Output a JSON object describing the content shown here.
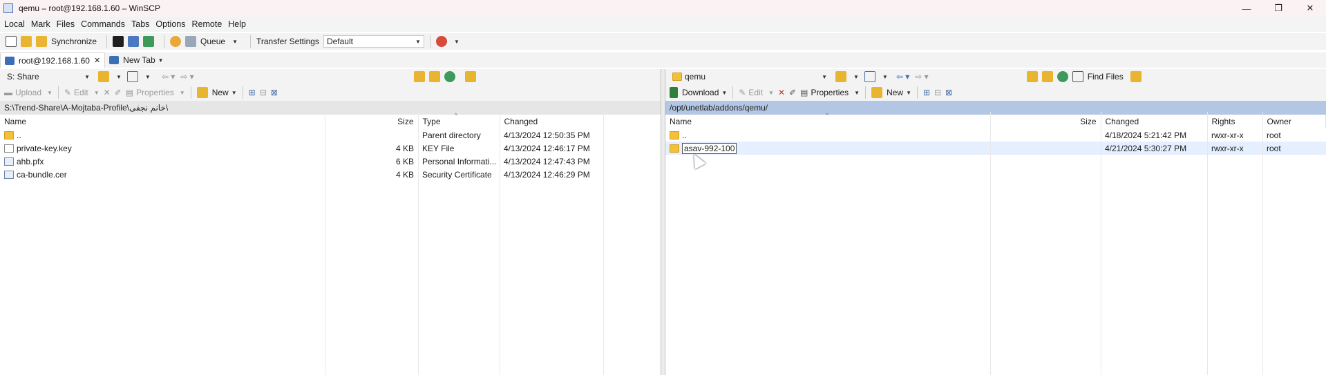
{
  "window": {
    "title": "qemu – root@192.168.1.60 – WinSCP",
    "controls": [
      "—",
      "❐",
      "✕"
    ]
  },
  "menu": [
    "Local",
    "Mark",
    "Files",
    "Commands",
    "Tabs",
    "Options",
    "Remote",
    "Help"
  ],
  "toolbar": {
    "synchronize": "Synchronize",
    "queue": "Queue",
    "transfer_settings": "Transfer Settings",
    "transfer_profile": "Default"
  },
  "tabs": [
    {
      "label": "root@192.168.1.60",
      "close": "✕"
    },
    {
      "label": "New Tab"
    }
  ],
  "left": {
    "drive": "S: Share",
    "actions": {
      "upload": "Upload",
      "edit": "Edit",
      "properties": "Properties",
      "new": "New"
    },
    "path": "S:\\Trend-Share\\A-Mojtaba-Profile\\خانم نجفی\\",
    "columns": [
      "Name",
      "Size",
      "Type",
      "Changed"
    ],
    "rows": [
      {
        "name": "..",
        "size": "",
        "type": "Parent directory",
        "changed": "4/13/2024 12:50:35 PM",
        "icon": "parent-folder"
      },
      {
        "name": "private-key.key",
        "size": "4 KB",
        "type": "KEY File",
        "changed": "4/13/2024 12:46:17 PM",
        "icon": "file"
      },
      {
        "name": "ahb.pfx",
        "size": "6 KB",
        "type": "Personal Informati...",
        "changed": "4/13/2024 12:47:43 PM",
        "icon": "certificate"
      },
      {
        "name": "ca-bundle.cer",
        "size": "4 KB",
        "type": "Security Certificate",
        "changed": "4/13/2024 12:46:29 PM",
        "icon": "certificate"
      }
    ]
  },
  "right": {
    "folder": "qemu",
    "actions": {
      "download": "Download",
      "edit": "Edit",
      "properties": "Properties",
      "new": "New",
      "find_files": "Find Files"
    },
    "path": "/opt/unetlab/addons/qemu/",
    "columns": [
      "Name",
      "Size",
      "Changed",
      "Rights",
      "Owner"
    ],
    "rows": [
      {
        "name": "..",
        "size": "",
        "changed": "4/18/2024 5:21:42 PM",
        "rights": "rwxr-xr-x",
        "owner": "root",
        "icon": "parent-folder"
      },
      {
        "name": "asav-992-100",
        "size": "",
        "changed": "4/21/2024 5:30:27 PM",
        "rights": "rwxr-xr-x",
        "owner": "root",
        "icon": "folder"
      }
    ]
  },
  "colors": {
    "active_path": "#b3c6e3",
    "inactive_path": "#e6e6e6",
    "selected_row": "#e5efff"
  }
}
